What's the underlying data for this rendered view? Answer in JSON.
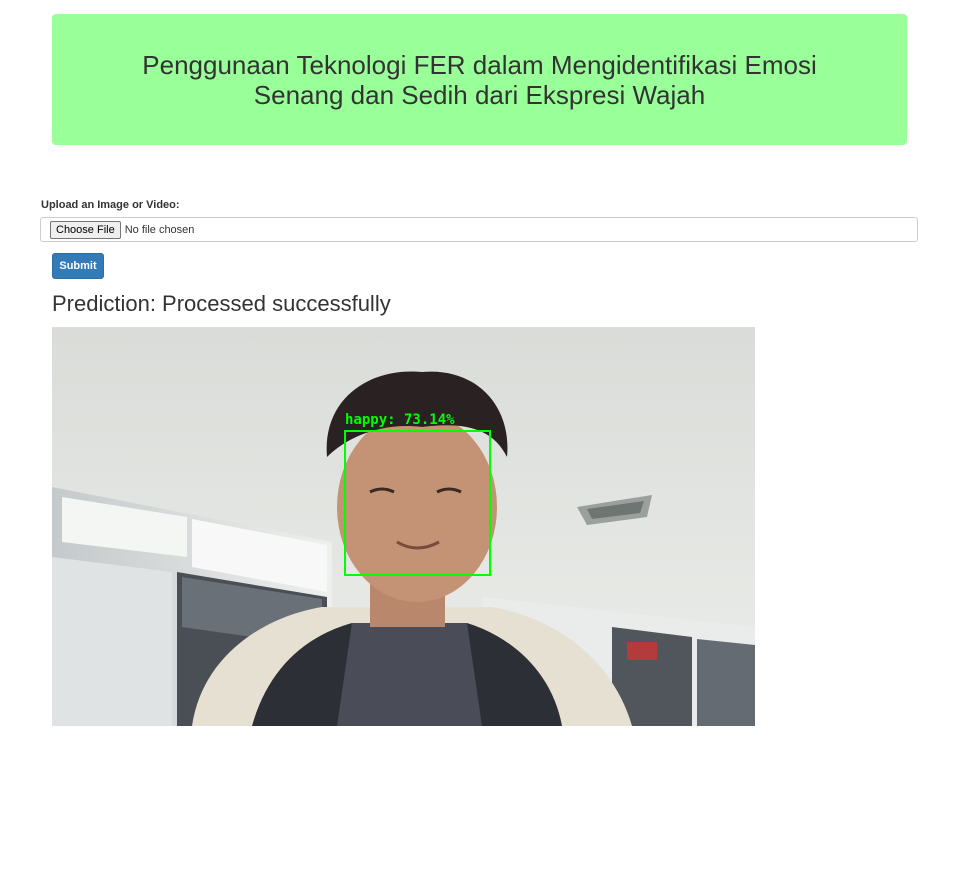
{
  "header": {
    "title": "Penggunaan Teknologi FER dalam Mengidentifikasi Emosi Senang dan Sedih dari Ekspresi Wajah"
  },
  "upload": {
    "label": "Upload an Image or Video:",
    "choose_button": "Choose File",
    "status": "No file chosen"
  },
  "submit": {
    "label": "Submit"
  },
  "prediction": {
    "text": "Prediction: Processed successfully"
  },
  "result": {
    "detection_label": "happy: 73.14%",
    "box_color": "#00ff00"
  },
  "colors": {
    "banner": "#99ff99",
    "submit_button": "#337ab7"
  }
}
